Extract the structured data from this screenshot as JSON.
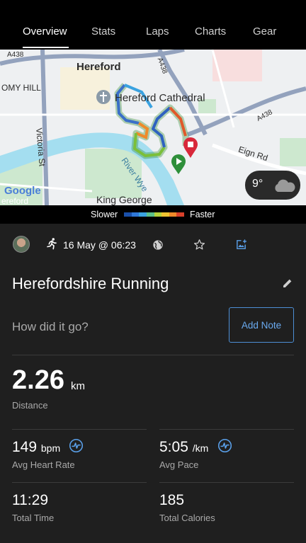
{
  "tabs": [
    {
      "label": "Overview",
      "active": true
    },
    {
      "label": "Stats",
      "active": false
    },
    {
      "label": "Laps",
      "active": false
    },
    {
      "label": "Charts",
      "active": false
    },
    {
      "label": "Gear",
      "active": false
    }
  ],
  "map": {
    "labels": {
      "city": "Hereford",
      "hill": "OMY HILL",
      "cathedral": "Hereford Cathedral",
      "victoria_st": "Victoria St",
      "river": "River Wye",
      "eign_rd": "Eign Rd",
      "king_george": "King George",
      "a438_left": "A438",
      "a438_mid": "A438",
      "a438_right": "A438",
      "google": "Google",
      "hereford_bottom": "ereford"
    },
    "weather": {
      "temp": "9°",
      "icon": "cloud-icon"
    }
  },
  "legend": {
    "slower": "Slower",
    "faster": "Faster",
    "colors": [
      "#1a4fa8",
      "#2f78d8",
      "#3aa2e0",
      "#5cc08a",
      "#b6d23c",
      "#f0c431",
      "#ee8a2a",
      "#d8402a"
    ]
  },
  "activity": {
    "date": "16 May @ 06:23",
    "title": "Herefordshire Running",
    "prompt": "How did it go?",
    "add_note": "Add Note"
  },
  "stats": {
    "distance": {
      "value": "2.26",
      "unit": "km",
      "label": "Distance"
    },
    "heart_rate": {
      "value": "149",
      "unit": "bpm",
      "label": "Avg Heart Rate"
    },
    "pace": {
      "value": "5:05",
      "unit": "/km",
      "label": "Avg Pace"
    },
    "time": {
      "value": "11:29",
      "label": "Total Time"
    },
    "calories": {
      "value": "185",
      "label": "Total Calories"
    }
  },
  "colors": {
    "accent": "#5aa0ea",
    "background": "#1f1f1f"
  }
}
